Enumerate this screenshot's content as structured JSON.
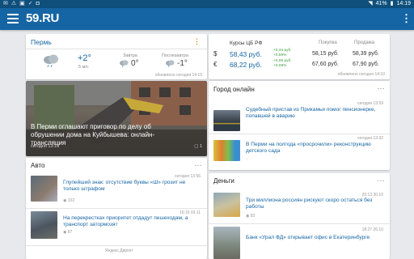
{
  "status_bar": {
    "left_icons": [
      "mail-icon",
      "alert-icon",
      "image-icon",
      "check-icon",
      "bag-icon"
    ],
    "time": "14:19",
    "battery": "41%"
  },
  "app": {
    "logo": "59.RU",
    "colors": {
      "primary": "#1565a4",
      "statusbar": "#0e4f7c",
      "accent": "#e08a1e",
      "positive": "#3a9b3a"
    }
  },
  "weather": {
    "city": "Пермь",
    "now_temp": "+2°",
    "now_wind": "5 м/с",
    "tomorrow_label": "Завтра",
    "tomorrow_temp": "0°",
    "day_after_label": "Послезавтра",
    "day_after_temp": "-1°",
    "updated": "обновлено сегодня 14:10"
  },
  "currency": {
    "title": "Курсы ЦБ РФ",
    "buy_label": "Покупка",
    "sell_label": "Продажа",
    "rows": [
      {
        "symbol": "$",
        "rate": "58,43 руб.",
        "delta1": "+0,34 руб.",
        "delta2": "+0,59%",
        "buy": "58,15 руб.",
        "sell": "58,39 руб."
      },
      {
        "symbol": "€",
        "rate": "68,22 руб.",
        "delta1": "+0,06 руб.",
        "delta2": "+0,09%",
        "buy": "67,60 руб.",
        "sell": "67,90 руб."
      }
    ],
    "updated": "обновлено сегодня 14:10"
  },
  "hero": {
    "title": "В Перми оглашают приговор по делу об обрушении дома на Куйбышева: онлайн-трансляция",
    "meta": "сегодня 13:16",
    "count": "1"
  },
  "auto": {
    "title": "Авто",
    "items": [
      {
        "date": "сегодня 13:56",
        "title": "Глупейший знак: отсутствие буквы «Ш» грозит не только штрафом",
        "meta": "102"
      },
      {
        "date": "16:15 03.11",
        "title": "На перекрестках приоритет отдадут пешеходам, а транспорт затормозят",
        "meta": "87"
      }
    ],
    "footer": "Яндекс.Директ"
  },
  "city": {
    "title": "Город онлайн",
    "items": [
      {
        "date": "сегодня 13:59",
        "title": "Судебный пристав из Прикамья помог пенсионерке, попавшей в аварию",
        "meta": ""
      },
      {
        "date": "сегодня 13:32",
        "title": "В Перми на полгода «просрочили» реконструкцию детского сада",
        "meta": ""
      }
    ]
  },
  "money": {
    "title": "Деньги",
    "items": [
      {
        "date": "20:13 30.10",
        "title": "Три миллиона россиян рискуют скоро остаться без работы",
        "meta": "83"
      },
      {
        "date": "18:27 26.10",
        "title": "Банк «Урал ФД» открывает офис в Екатеринбурге",
        "meta": ""
      }
    ]
  }
}
